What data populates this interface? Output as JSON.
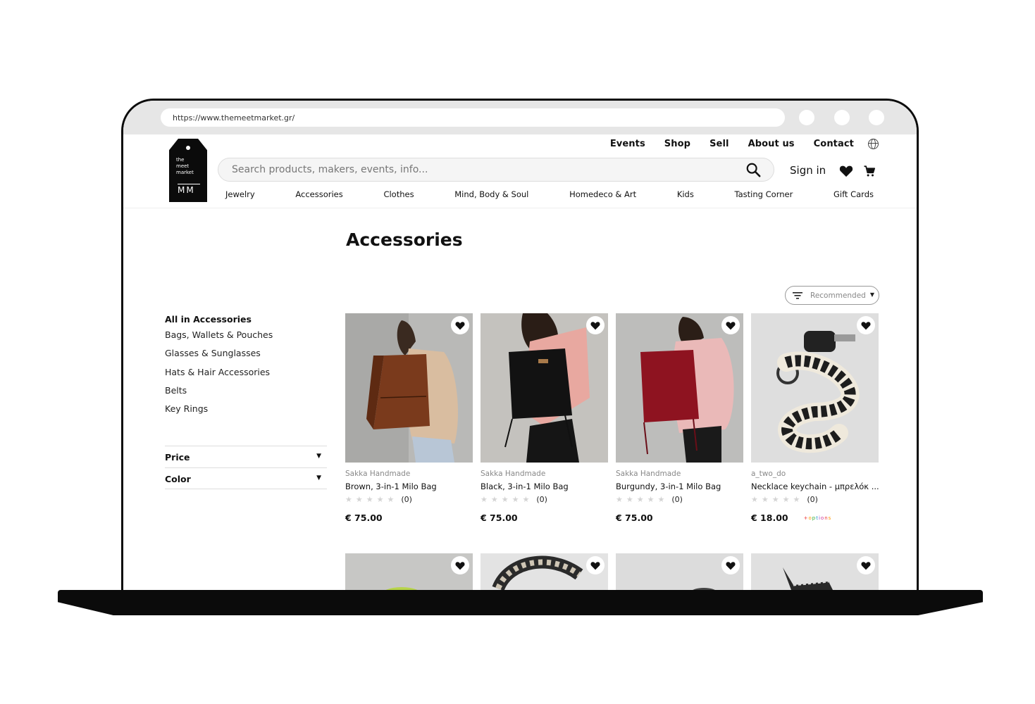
{
  "browser": {
    "url": "https://www.themeetmarket.gr/"
  },
  "logo": {
    "line1": "the",
    "line2": "meet",
    "line3": "market",
    "mark": "MM"
  },
  "top_nav": [
    "Events",
    "Shop",
    "Sell",
    "About us",
    "Contact"
  ],
  "search": {
    "placeholder": "Search products, makers, events, info..."
  },
  "account": {
    "sign_in": "Sign in"
  },
  "categories": [
    "Jewelry",
    "Accessories",
    "Clothes",
    "Mind, Body & Soul",
    "Homedeco & Art",
    "Kids",
    "Tasting Corner",
    "Gift Cards"
  ],
  "page": {
    "title": "Accessories"
  },
  "sort": {
    "selected": "Recommended"
  },
  "sidebar": {
    "all": "All in Accessories",
    "subcategories": [
      "Bags, Wallets & Pouches",
      "Glasses & Sunglasses",
      "Hats & Hair Accessories",
      "Belts",
      "Key Rings"
    ],
    "filters": [
      "Price",
      "Color"
    ]
  },
  "products": [
    {
      "maker": "Sakka Handmade",
      "name": "Brown, 3-in-1 Milo Bag",
      "reviews": "(0)",
      "price": "€ 75.00",
      "bag_color": "#7a3a1c"
    },
    {
      "maker": "Sakka Handmade",
      "name": "Black, 3-in-1 Milo Bag",
      "reviews": "(0)",
      "price": "€ 75.00",
      "bag_color": "#111111"
    },
    {
      "maker": "Sakka Handmade",
      "name": "Burgundy, 3-in-1 Milo Bag",
      "reviews": "(0)",
      "price": "€ 75.00",
      "bag_color": "#8e1320"
    },
    {
      "maker": "a_two_do",
      "name": "Necklace keychain - μπρελόκ ...",
      "reviews": "(0)",
      "price": "€ 18.00",
      "badge": "+options"
    }
  ]
}
